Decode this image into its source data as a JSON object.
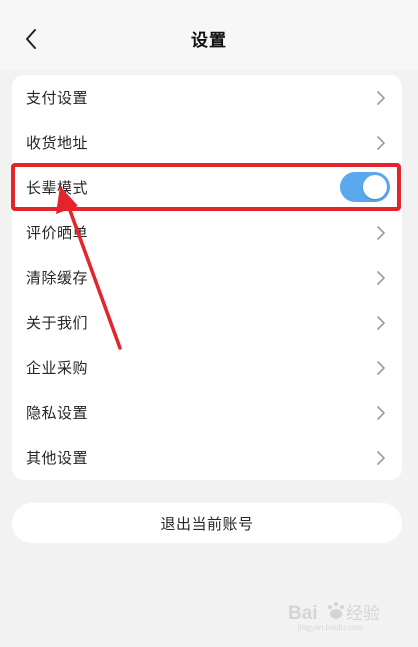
{
  "header": {
    "title": "设置",
    "back_icon": "chevron-left-icon"
  },
  "settings": {
    "items": [
      {
        "label": "支付设置",
        "type": "link"
      },
      {
        "label": "收货地址",
        "type": "link"
      },
      {
        "label": "长辈模式",
        "type": "toggle",
        "enabled": true
      },
      {
        "label": "评价晒单",
        "type": "link"
      },
      {
        "label": "清除缓存",
        "type": "link"
      },
      {
        "label": "关于我们",
        "type": "link"
      },
      {
        "label": "企业采购",
        "type": "link"
      },
      {
        "label": "隐私设置",
        "type": "link"
      },
      {
        "label": "其他设置",
        "type": "link"
      }
    ]
  },
  "logout": {
    "label": "退出当前账号"
  },
  "colors": {
    "toggle_on": "#5aa9ee",
    "highlight": "#e3242b",
    "card_bg": "#ffffff",
    "page_bg": "#f2f2f2"
  },
  "watermark": {
    "text": "Bai经验",
    "subtext": "jingyan.baidu.com"
  }
}
